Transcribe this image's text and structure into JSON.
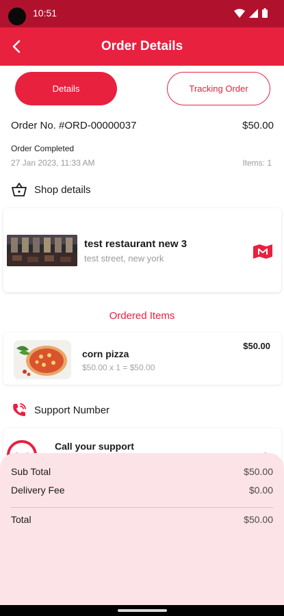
{
  "status_bar": {
    "time": "10:51"
  },
  "app_bar": {
    "title": "Order Details"
  },
  "tabs": [
    {
      "label": "Details",
      "active": true
    },
    {
      "label": "Tracking Order",
      "active": false
    }
  ],
  "order": {
    "number": "Order No. #ORD-00000037",
    "amount": "$50.00",
    "status": "Order Completed",
    "date": "27 Jan 2023, 11:33 AM",
    "items_count": "Items: 1"
  },
  "shop_section": {
    "header": "Shop details",
    "name": "test restaurant new 3",
    "address": "test street, new york"
  },
  "ordered_items": {
    "title": "Ordered Items",
    "items": [
      {
        "name": "corn pizza",
        "calc": "$50.00 x 1 = $50.00",
        "price": "$50.00"
      }
    ]
  },
  "support": {
    "header": "Support Number",
    "call_text": "Call your support",
    "mark": ","
  },
  "summary": {
    "subtotal_label": "Sub Total",
    "subtotal_value": "$50.00",
    "delivery_label": "Delivery Fee",
    "delivery_value": "$0.00",
    "total_label": "Total",
    "total_value": "$50.00"
  },
  "colors": {
    "primary": "#e8213f",
    "status_bar": "#b0122e",
    "summary_bg": "#fbe3e7"
  }
}
